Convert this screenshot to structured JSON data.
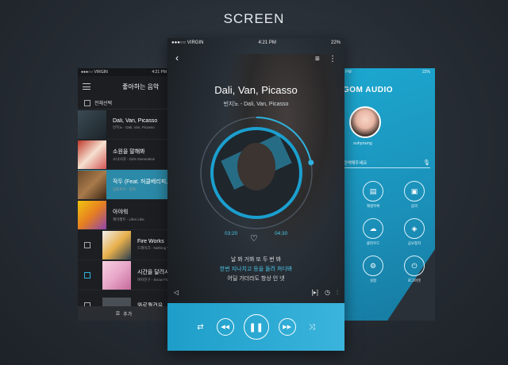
{
  "page": {
    "title": "SCREEN"
  },
  "left_phone": {
    "status": {
      "carrier": "●●●○○ VIRGIN",
      "time": "4:21 PM"
    },
    "header_title": "좋아하는 음악",
    "select_all": "전체선택",
    "songs": [
      {
        "title": "Dali, Van, Picasso",
        "artist": "빈지노 - Dali, Van, Picasso"
      },
      {
        "title": "소원을 말해봐",
        "artist": "소녀시대 - Girls Generation"
      },
      {
        "title": "작두 (Feat. 허클베리피, 도끼)",
        "artist": "딥플로우 - 양화"
      },
      {
        "title": "아야워",
        "artist": "제이켓트 - Lifes Like"
      },
      {
        "title": "Fire Works",
        "artist": "드레이크 - Nothing Was"
      },
      {
        "title": "시간을 달려서",
        "artist": "여자친구 - Snow Flake"
      },
      {
        "title": "와로퀄건우",
        "artist": ""
      }
    ],
    "add_label": "추가"
  },
  "center_phone": {
    "status": {
      "carrier": "●●●○○ VIRGIN",
      "time": "4:21 PM",
      "battery": "22%"
    },
    "song_title": "Dali, Van, Picasso",
    "song_subtitle": "빈지노 - Dali, Van, Picasso",
    "progress": 0.22,
    "time_elapsed": "03:20",
    "time_total": "04:30",
    "lyrics": [
      "날 봐 거봐 또 두 번 봐",
      "한번 지나치고 등을 돌려 쳐다봐",
      "어딜 가더라도 항상 인 넷"
    ],
    "active_lyric_index": 1
  },
  "right_phone": {
    "status": {
      "time": "4:21 PM",
      "battery": "22%"
    },
    "brand": "GOM AUDIO",
    "username": "suhyoung",
    "search_placeholder": "검색해주세요",
    "menu": [
      {
        "label": "재생목록",
        "icon": "playlist-icon"
      },
      {
        "label": "음악",
        "icon": "music-icon"
      },
      {
        "label": "클라우드",
        "icon": "cloud-icon"
      },
      {
        "label": "곰보청지",
        "icon": "diamond-icon"
      },
      {
        "label": "설정",
        "icon": "settings-icon"
      },
      {
        "label": "로그아웃",
        "icon": "power-icon"
      }
    ]
  },
  "colors": {
    "accent": "#2fb2dd",
    "background": "#2a3037"
  }
}
